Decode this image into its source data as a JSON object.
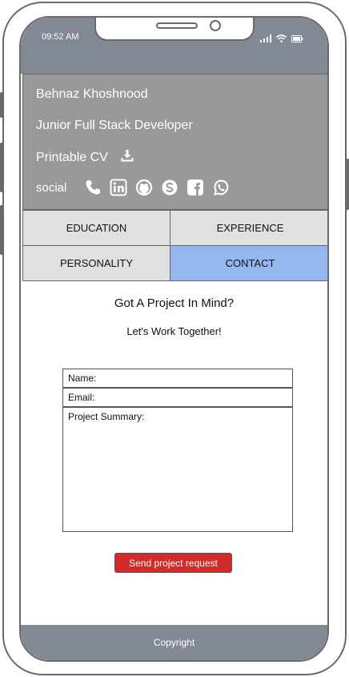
{
  "status_bar": {
    "time": "09:52 AM",
    "icons": [
      "signal-icon",
      "wifi-icon",
      "battery-icon"
    ]
  },
  "profile": {
    "name": "Behnaz Khoshnood",
    "title": "Junior Full Stack Developer",
    "cv_label": "Printable CV",
    "social_label": "social",
    "social_icons": [
      "phone-icon",
      "linkedin-icon",
      "github-icon",
      "skype-icon",
      "facebook-icon",
      "whatsapp-icon"
    ]
  },
  "tabs": [
    {
      "label": "EDUCATION",
      "active": false
    },
    {
      "label": "EXPERIENCE",
      "active": false
    },
    {
      "label": "PERSONALITY",
      "active": false
    },
    {
      "label": "CONTACT",
      "active": true
    }
  ],
  "contact": {
    "heading": "Got A Project In Mind?",
    "subheading": "Let's Work Together!",
    "name_label": "Name:",
    "email_label": "Email:",
    "summary_label": "Project Summary:",
    "send_label": "Send project request"
  },
  "footer": {
    "text": "Copyright"
  },
  "colors": {
    "header_bg": "#828894",
    "profile_bg": "#999999",
    "tab_bg": "#e0e0e0",
    "tab_active_bg": "#94b7f0",
    "send_button_bg": "#d32b2b"
  }
}
